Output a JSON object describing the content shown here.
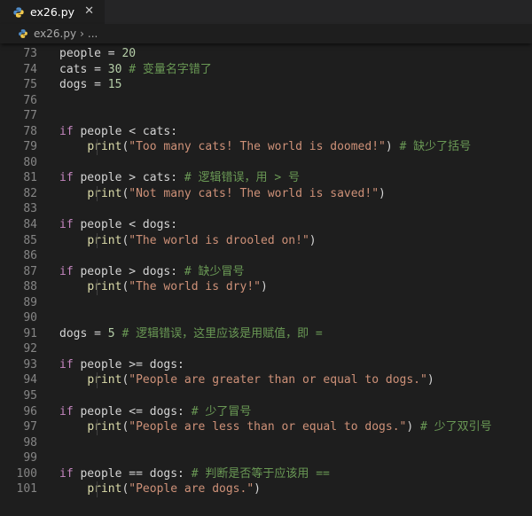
{
  "tab": {
    "label": "ex26.py",
    "close_glyph": "✕",
    "icon": "python-icon"
  },
  "breadcrumb": {
    "file": "ex26.py",
    "chevron": "›",
    "more": "..."
  },
  "colors": {
    "keyword": "#c586c0",
    "string": "#ce9178",
    "number": "#b5cea8",
    "comment": "#6a9955",
    "function": "#dcdcaa",
    "text": "#d4d4d4",
    "line_number": "#858585"
  },
  "lines": [
    {
      "n": "73",
      "indent": false,
      "tokens": [
        {
          "t": "vr",
          "v": "people = "
        },
        {
          "t": "num",
          "v": "20"
        }
      ]
    },
    {
      "n": "74",
      "indent": false,
      "tokens": [
        {
          "t": "vr",
          "v": "cats = "
        },
        {
          "t": "num",
          "v": "30"
        },
        {
          "t": "vr",
          "v": " "
        },
        {
          "t": "cm",
          "v": "# 变量名字错了"
        }
      ]
    },
    {
      "n": "75",
      "indent": false,
      "tokens": [
        {
          "t": "vr",
          "v": "dogs = "
        },
        {
          "t": "num",
          "v": "15"
        }
      ]
    },
    {
      "n": "76",
      "indent": false,
      "tokens": []
    },
    {
      "n": "77",
      "indent": false,
      "tokens": []
    },
    {
      "n": "78",
      "indent": false,
      "tokens": [
        {
          "t": "kw",
          "v": "if"
        },
        {
          "t": "vr",
          "v": " people < cats:"
        }
      ]
    },
    {
      "n": "79",
      "indent": true,
      "tokens": [
        {
          "t": "vr",
          "v": "    "
        },
        {
          "t": "fn",
          "v": "print"
        },
        {
          "t": "vr",
          "v": "("
        },
        {
          "t": "str",
          "v": "\"Too many cats! The world is doomed!\""
        },
        {
          "t": "vr",
          "v": ") "
        },
        {
          "t": "cm",
          "v": "# 缺少了括号"
        }
      ]
    },
    {
      "n": "80",
      "indent": false,
      "tokens": []
    },
    {
      "n": "81",
      "indent": false,
      "tokens": [
        {
          "t": "kw",
          "v": "if"
        },
        {
          "t": "vr",
          "v": " people > cats: "
        },
        {
          "t": "cm",
          "v": "# 逻辑错误，用 > 号"
        }
      ]
    },
    {
      "n": "82",
      "indent": true,
      "tokens": [
        {
          "t": "vr",
          "v": "    "
        },
        {
          "t": "fn",
          "v": "print"
        },
        {
          "t": "vr",
          "v": "("
        },
        {
          "t": "str",
          "v": "\"Not many cats! The world is saved!\""
        },
        {
          "t": "vr",
          "v": ")"
        }
      ]
    },
    {
      "n": "83",
      "indent": false,
      "tokens": []
    },
    {
      "n": "84",
      "indent": false,
      "tokens": [
        {
          "t": "kw",
          "v": "if"
        },
        {
          "t": "vr",
          "v": " people < dogs:"
        }
      ]
    },
    {
      "n": "85",
      "indent": true,
      "tokens": [
        {
          "t": "vr",
          "v": "    "
        },
        {
          "t": "fn",
          "v": "print"
        },
        {
          "t": "vr",
          "v": "("
        },
        {
          "t": "str",
          "v": "\"The world is drooled on!\""
        },
        {
          "t": "vr",
          "v": ")"
        }
      ]
    },
    {
      "n": "86",
      "indent": false,
      "tokens": []
    },
    {
      "n": "87",
      "indent": false,
      "tokens": [
        {
          "t": "kw",
          "v": "if"
        },
        {
          "t": "vr",
          "v": " people > dogs: "
        },
        {
          "t": "cm",
          "v": "# 缺少冒号"
        }
      ]
    },
    {
      "n": "88",
      "indent": true,
      "tokens": [
        {
          "t": "vr",
          "v": "    "
        },
        {
          "t": "fn",
          "v": "print"
        },
        {
          "t": "vr",
          "v": "("
        },
        {
          "t": "str",
          "v": "\"The world is dry!\""
        },
        {
          "t": "vr",
          "v": ")"
        }
      ]
    },
    {
      "n": "89",
      "indent": false,
      "tokens": []
    },
    {
      "n": "90",
      "indent": false,
      "tokens": []
    },
    {
      "n": "91",
      "indent": false,
      "tokens": [
        {
          "t": "vr",
          "v": "dogs = "
        },
        {
          "t": "num",
          "v": "5"
        },
        {
          "t": "vr",
          "v": " "
        },
        {
          "t": "cm",
          "v": "# 逻辑错误，这里应该是用赋值，即 ="
        }
      ]
    },
    {
      "n": "92",
      "indent": false,
      "tokens": []
    },
    {
      "n": "93",
      "indent": false,
      "tokens": [
        {
          "t": "kw",
          "v": "if"
        },
        {
          "t": "vr",
          "v": " people >= dogs:"
        }
      ]
    },
    {
      "n": "94",
      "indent": true,
      "tokens": [
        {
          "t": "vr",
          "v": "    "
        },
        {
          "t": "fn",
          "v": "print"
        },
        {
          "t": "vr",
          "v": "("
        },
        {
          "t": "str",
          "v": "\"People are greater than or equal to dogs.\""
        },
        {
          "t": "vr",
          "v": ")"
        }
      ]
    },
    {
      "n": "95",
      "indent": false,
      "tokens": []
    },
    {
      "n": "96",
      "indent": false,
      "tokens": [
        {
          "t": "kw",
          "v": "if"
        },
        {
          "t": "vr",
          "v": " people <= dogs: "
        },
        {
          "t": "cm",
          "v": "# 少了冒号"
        }
      ]
    },
    {
      "n": "97",
      "indent": true,
      "tokens": [
        {
          "t": "vr",
          "v": "    "
        },
        {
          "t": "fn",
          "v": "print"
        },
        {
          "t": "vr",
          "v": "("
        },
        {
          "t": "str",
          "v": "\"People are less than or equal to dogs.\""
        },
        {
          "t": "vr",
          "v": ") "
        },
        {
          "t": "cm",
          "v": "# 少了双引号"
        }
      ]
    },
    {
      "n": "98",
      "indent": false,
      "tokens": []
    },
    {
      "n": "99",
      "indent": false,
      "tokens": []
    },
    {
      "n": "100",
      "indent": false,
      "tokens": [
        {
          "t": "kw",
          "v": "if"
        },
        {
          "t": "vr",
          "v": " people == dogs: "
        },
        {
          "t": "cm",
          "v": "# 判断是否等于应该用 =="
        }
      ]
    },
    {
      "n": "101",
      "indent": true,
      "tokens": [
        {
          "t": "vr",
          "v": "    "
        },
        {
          "t": "fn",
          "v": "print"
        },
        {
          "t": "vr",
          "v": "("
        },
        {
          "t": "str",
          "v": "\"People are dogs.\""
        },
        {
          "t": "vr",
          "v": ")"
        }
      ]
    }
  ]
}
